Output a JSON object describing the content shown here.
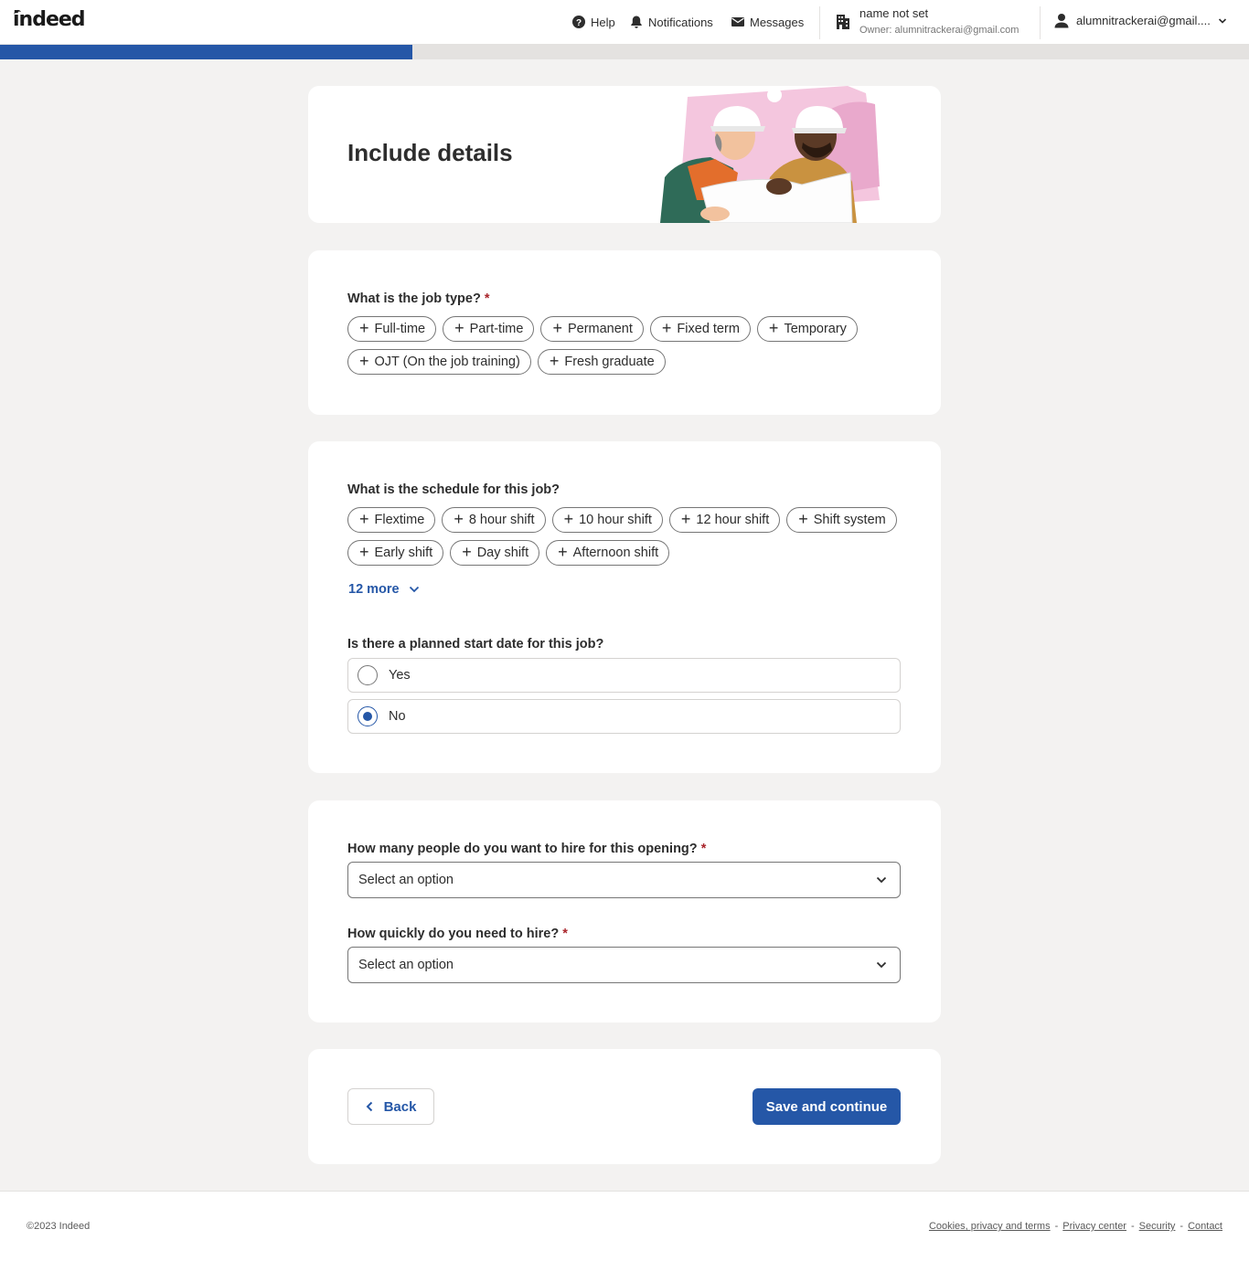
{
  "header": {
    "logo": "indeed",
    "nav": [
      {
        "label": "Help",
        "icon": "help-circle-icon"
      },
      {
        "label": "Notifications",
        "icon": "bell-icon"
      },
      {
        "label": "Messages",
        "icon": "envelope-icon"
      }
    ],
    "company_name": "name not set",
    "company_owner": "Owner: alumnitrackerai@gmail.com",
    "account_email": "alumnitrackerai@gmail...."
  },
  "progress": {
    "fraction": 0.33,
    "color": "#2557a7"
  },
  "intro": {
    "title": "Include details"
  },
  "job_type": {
    "question": "What is the job type?",
    "required_mark": "*",
    "options": [
      "Full-time",
      "Part-time",
      "Permanent",
      "Fixed term",
      "Temporary",
      "OJT (On the job training)",
      "Fresh graduate"
    ]
  },
  "schedule": {
    "question": "What is the schedule for this job?",
    "options": [
      "Flextime",
      "8 hour shift",
      "10 hour shift",
      "12 hour shift",
      "Shift system",
      "Early shift",
      "Day shift",
      "Afternoon shift"
    ],
    "more_label": "12 more"
  },
  "start_date": {
    "question": "Is there a planned start date for this job?",
    "options": [
      {
        "label": "Yes",
        "selected": false
      },
      {
        "label": "No",
        "selected": true
      }
    ]
  },
  "hiring": {
    "people_question": "How many people do you want to hire for this opening?",
    "people_value": "Select an option",
    "speed_question": "How quickly do you need to hire?",
    "speed_value": "Select an option",
    "required_mark": "*"
  },
  "actions": {
    "back_label": "Back",
    "save_label": "Save and continue"
  },
  "footer": {
    "copyright": "©2023 Indeed",
    "links": [
      "Cookies, privacy and terms",
      "Privacy center",
      "Security",
      "Contact"
    ],
    "separator": "-"
  },
  "colors": {
    "accent": "#2557a7",
    "required": "#a9252b",
    "background": "#f3f2f1"
  }
}
